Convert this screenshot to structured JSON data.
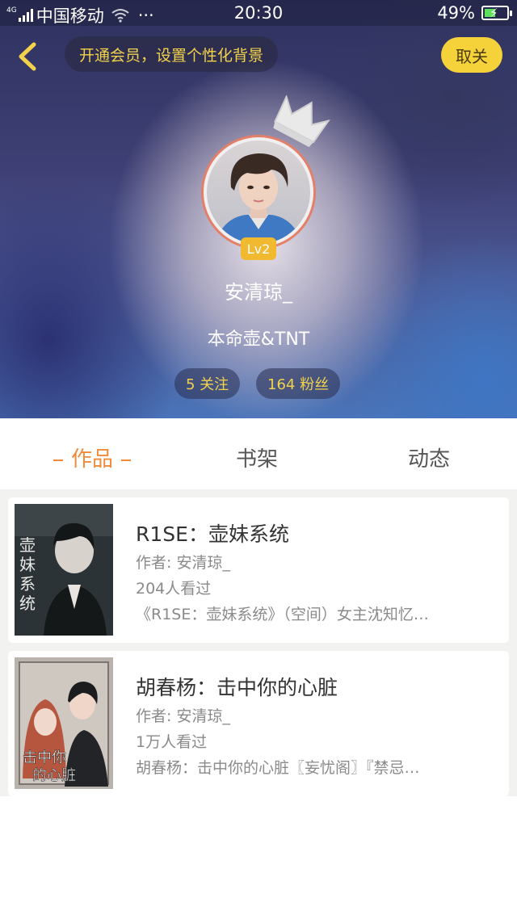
{
  "status_bar": {
    "network": "4G",
    "carrier": "中国移动",
    "more": "···",
    "time": "20:30",
    "battery_percent": "49%",
    "battery_level": 0.49
  },
  "header": {
    "vip_banner": "开通会员，设置个性化背景",
    "unfollow_label": "取关"
  },
  "profile": {
    "level": "Lv2",
    "username": "安清琼_",
    "signature": "本命壶&TNT",
    "following": "5 关注",
    "fans": "164 粉丝"
  },
  "tabs": [
    {
      "label": "作品",
      "active": true
    },
    {
      "label": "书架",
      "active": false
    },
    {
      "label": "动态",
      "active": false
    }
  ],
  "books": [
    {
      "title": "R1SE：壶妹系统",
      "author": "作者: 安清琼_",
      "views": "204人看过",
      "description": "《R1SE：壶妹系统》（空间）女主沈知忆…",
      "cover_title": "壶妹系统"
    },
    {
      "title": "胡春杨：击中你的心脏",
      "author": "作者: 安清琼_",
      "views": "1万人看过",
      "description": "胡春杨：击中你的心脏〖妄忧阁〗『禁忌…",
      "cover_title": "击中你的心脏"
    }
  ],
  "colors": {
    "accent": "#f08a3b",
    "gold": "#f3d24b",
    "unfollow_bg": "#f6d23a"
  }
}
